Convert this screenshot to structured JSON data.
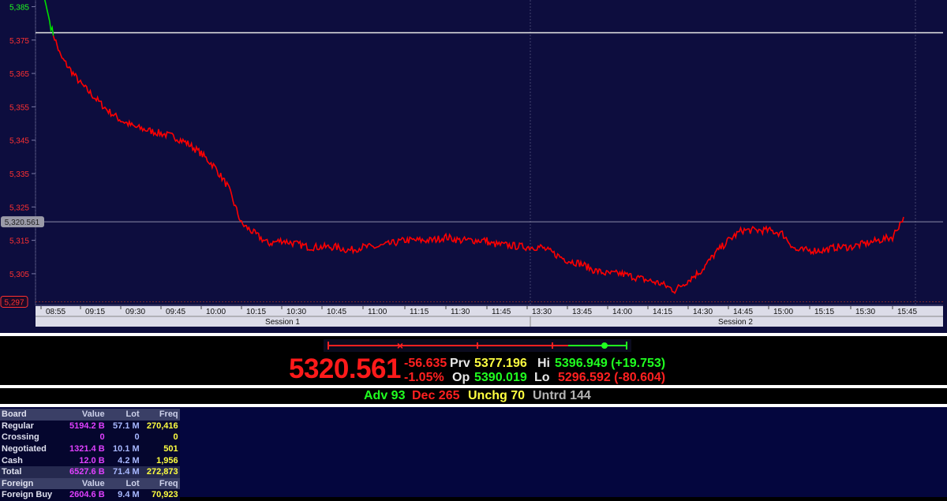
{
  "chart": {
    "y_ticks": [
      "5,385",
      "5,375",
      "5,365",
      "5,355",
      "5,345",
      "5,335",
      "5,325",
      "5,315",
      "5,305"
    ],
    "current_price_marker": "5,320.561",
    "low_marker": "5,297",
    "x_ticks": [
      "08:55",
      "09:15",
      "09:30",
      "09:45",
      "10:00",
      "10:15",
      "10:30",
      "10:45",
      "11:00",
      "11:15",
      "11:30",
      "11:45",
      "13:30",
      "13:45",
      "14:00",
      "14:15",
      "14:30",
      "14:45",
      "15:00",
      "15:15",
      "15:30",
      "15:45"
    ],
    "sessions": [
      "Session 1",
      "Session 2"
    ]
  },
  "chart_data": {
    "type": "line",
    "xlabel": "",
    "ylabel": "",
    "ylim": [
      5296,
      5387
    ],
    "reference_line": 5377.196,
    "x": [
      "08:55",
      "09:00",
      "09:05",
      "09:10",
      "09:15",
      "09:20",
      "09:25",
      "09:30",
      "09:35",
      "09:40",
      "09:45",
      "09:50",
      "09:55",
      "10:00",
      "10:05",
      "10:10",
      "10:15",
      "10:20",
      "10:25",
      "10:30",
      "10:35",
      "10:40",
      "10:45",
      "10:50",
      "10:55",
      "11:00",
      "11:05",
      "11:10",
      "11:15",
      "11:20",
      "11:25",
      "11:30",
      "11:35",
      "11:40",
      "11:45",
      "11:50",
      "13:30",
      "13:35",
      "13:40",
      "13:45",
      "13:50",
      "13:55",
      "14:00",
      "14:05",
      "14:10",
      "14:15",
      "14:20",
      "14:25",
      "14:30",
      "14:35",
      "14:40",
      "14:45",
      "14:50",
      "14:55",
      "15:00",
      "15:05",
      "15:10",
      "15:15",
      "15:20",
      "15:25",
      "15:30",
      "15:35",
      "15:40",
      "15:45",
      "15:49"
    ],
    "series": [
      {
        "values": [
          5392,
          5379,
          5370,
          5366,
          5362,
          5358,
          5354,
          5351,
          5349,
          5348,
          5347,
          5346,
          5344,
          5341,
          5337,
          5331,
          5320,
          5317,
          5314,
          5315,
          5314,
          5313,
          5313,
          5313,
          5312,
          5313,
          5313,
          5314,
          5315,
          5315,
          5315,
          5316,
          5315,
          5315,
          5315,
          5314,
          5313,
          5313,
          5311,
          5309,
          5308,
          5306,
          5305,
          5305,
          5304,
          5303,
          5302,
          5300,
          5303,
          5306,
          5311,
          5315,
          5318,
          5318,
          5318,
          5317,
          5312,
          5312,
          5312,
          5313,
          5313,
          5314,
          5315,
          5316,
          5322
        ]
      }
    ]
  },
  "ticker": {
    "last": "5320.561",
    "change": "-56.635",
    "change_pct": "-1.05%",
    "prv_label": "Prv",
    "prv_value": "5377.196",
    "op_label": "Op",
    "op_value": "5390.019",
    "hi_label": "Hi",
    "hi_value": "5396.949 (+19.753)",
    "lo_label": "Lo",
    "lo_value": "5296.592 (-80.604)"
  },
  "breadth": {
    "adv": "Adv 93",
    "dec": "Dec 265",
    "unchg": "Unchg 70",
    "untrd": "Untrd 144"
  },
  "board": {
    "rows": [
      {
        "type": "hdr",
        "cells": [
          "Board",
          "Value",
          "Lot",
          "Freq"
        ]
      },
      {
        "type": "row",
        "cells": [
          "Regular",
          "5194.2 B",
          "57.1 M",
          "270,416"
        ]
      },
      {
        "type": "row",
        "cells": [
          "Crossing",
          "0",
          "0",
          "0"
        ]
      },
      {
        "type": "row",
        "cells": [
          "Negotiated",
          "1321.4 B",
          "10.1 M",
          "501"
        ]
      },
      {
        "type": "row",
        "cells": [
          "Cash",
          "12.0 B",
          "4.2 M",
          "1,956"
        ]
      },
      {
        "type": "tot",
        "cells": [
          "Total",
          "6527.6 B",
          "71.4 M",
          "272,873"
        ]
      },
      {
        "type": "hdr",
        "cells": [
          "Foreign",
          "Value",
          "Lot",
          "Freq"
        ]
      },
      {
        "type": "row",
        "cells": [
          "Foreign Buy",
          "2604.6 B",
          "9.4 M",
          "70,923"
        ]
      }
    ]
  },
  "colors": {
    "chart_bg": "#0d0d3e",
    "line_down": "#ff0000",
    "line_up": "#00e000",
    "axis_text": "#ff3030"
  }
}
